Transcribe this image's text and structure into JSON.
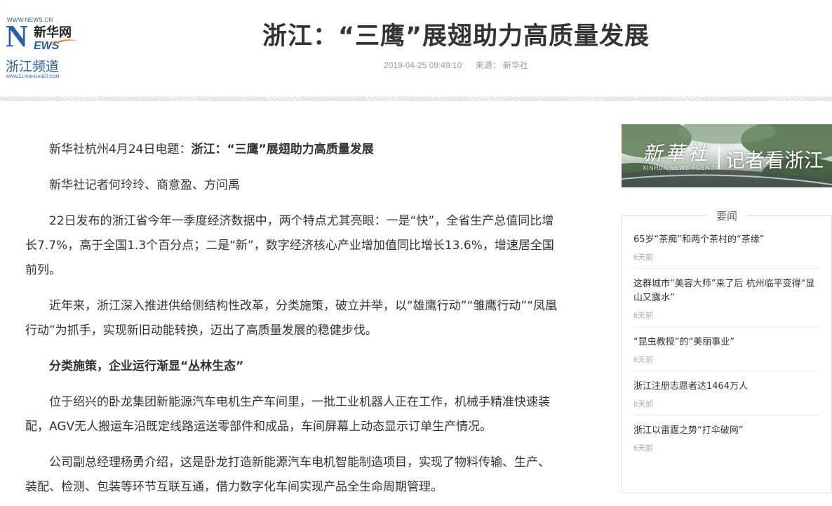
{
  "logo": {
    "url_text": "WWW.NEWS.CN",
    "n_letter": "N",
    "brand_cn": "新华网",
    "ews": "EWS",
    "channel": "浙江频道",
    "channel_url": "WWW.ZJ.XINHUANET.COM"
  },
  "article": {
    "title": "浙江：“三鹰”展翅助力高质量发展",
    "datetime": "2019-04-25 09:49:10",
    "source": "来源：  新华社",
    "dateline_prefix": "新华社杭州4月24日电题：",
    "dateline_title": "浙江：“三鹰”展翅助力高质量发展",
    "byline": "新华社记者何玲玲、商意盈、方问禹",
    "p1": "22日发布的浙江省今年一季度经济数据中，两个特点尤其亮眼：一是“快”，全省生产总值同比增长7.7%，高于全国1.3个百分点；二是“新”，数字经济核心产业增加值同比增长13.6%，增速居全国前列。",
    "p2": "近年来，浙江深入推进供给侧结构性改革，分类施策，破立并举，以“雄鹰行动”“雏鹰行动”“凤凰行动”为抓手，实现新旧动能转换，迈出了高质量发展的稳健步伐。",
    "subhead": "分类施策，企业运行渐显“丛林生态”",
    "p3": "位于绍兴的卧龙集团新能源汽车电机生产车间里，一批工业机器人正在工作，机械手精准快速装配，AGV无人搬运车沿既定线路运送零部件和成品，车间屏幕上动态显示订单生产情况。",
    "p4": "公司副总经理杨勇介绍，这是卧龙打造新能源汽车电机智能制造项目，实现了物料传输、生产、装配、检测、包装等环节互联互通，借力数字化车间实现产品全生命周期管理。"
  },
  "sidebar": {
    "banner": {
      "brand_cn": "新華社",
      "brand_en": "XINHUA NEWS AGENCY",
      "title": "记者看浙江"
    },
    "box_title": "要闻",
    "news": [
      {
        "title": "65岁“茶痴”和两个茶村的“茶缘”",
        "date": "6天前"
      },
      {
        "title": "这群城市“美容大师”来了后 杭州临平变得“显山又露水”",
        "date": "6天前"
      },
      {
        "title": "“昆虫教授”的“美丽事业”",
        "date": "6天前"
      },
      {
        "title": "浙江注册志愿者达1464万人",
        "date": "6天前"
      },
      {
        "title": "浙江以雷霆之势“打伞破网”",
        "date": "6天前"
      }
    ]
  }
}
